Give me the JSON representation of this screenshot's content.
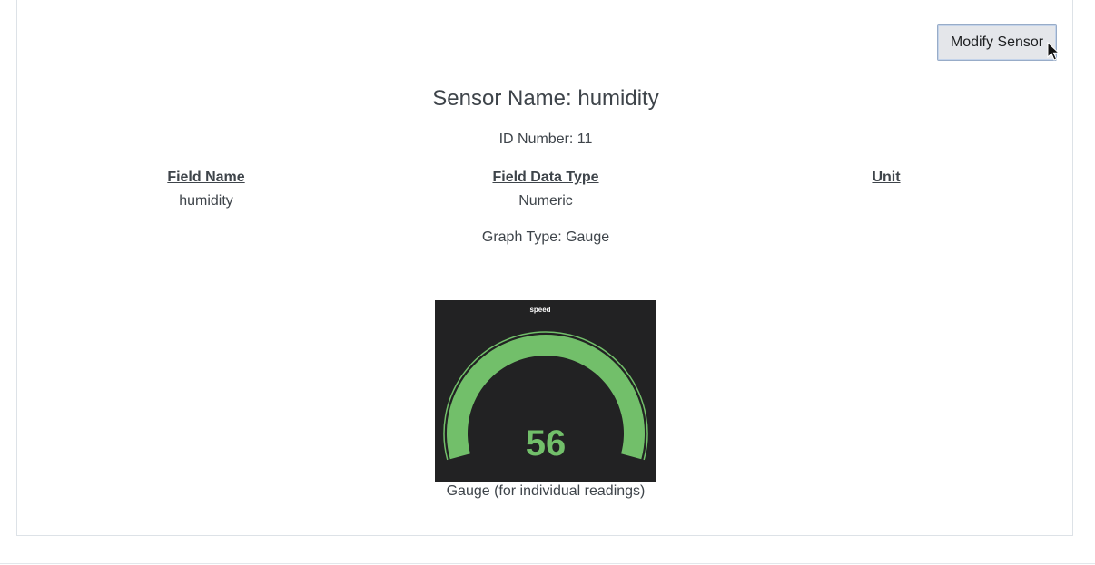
{
  "actions": {
    "modify_label": "Modify Sensor"
  },
  "sensor": {
    "name_line": "Sensor Name: humidity",
    "id_line": "ID Number: 11",
    "graph_type_line": "Graph Type: Gauge"
  },
  "fields_table": {
    "headers": [
      "Field Name",
      "Field Data Type",
      "Unit"
    ],
    "rows": [
      [
        "humidity",
        "Numeric",
        ""
      ]
    ]
  },
  "gauge": {
    "title": "speed",
    "value": 56,
    "value_text": "56",
    "min": 0,
    "max": 100,
    "caption": "Gauge (for individual readings)",
    "fill_color": "#72bf6a",
    "background_color": "#222223",
    "value_color": "#72bf6a"
  },
  "icons": {
    "cursor": "mouse-pointer-icon"
  }
}
